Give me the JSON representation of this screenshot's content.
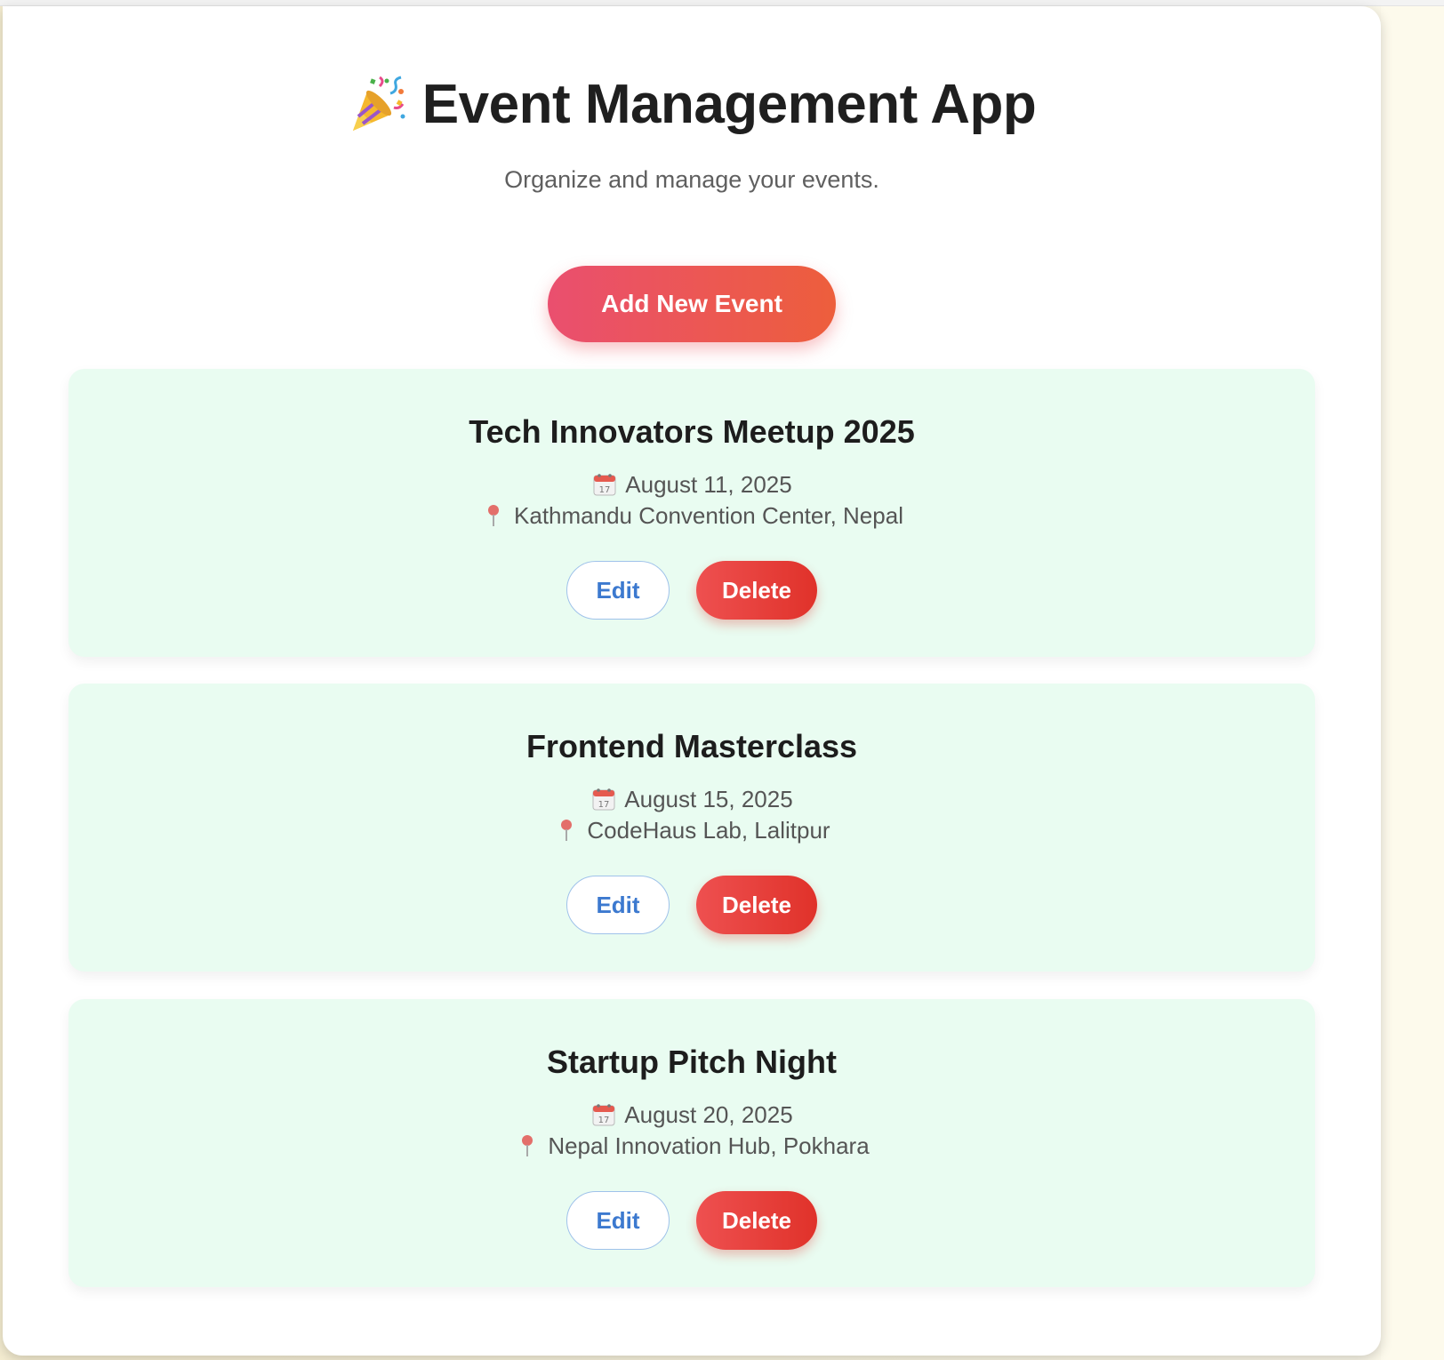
{
  "app": {
    "title": "Event Management App",
    "subtitle": "Organize and manage your events.",
    "title_icon": "party-popper-icon"
  },
  "actions": {
    "add_label": "Add New Event"
  },
  "events": [
    {
      "title": "Tech Innovators Meetup 2025",
      "date": "August 11, 2025",
      "location": "Kathmandu Convention Center, Nepal",
      "edit_label": "Edit",
      "delete_label": "Delete"
    },
    {
      "title": "Frontend Masterclass",
      "date": "August 15, 2025",
      "location": "CodeHaus Lab, Lalitpur",
      "edit_label": "Edit",
      "delete_label": "Delete"
    },
    {
      "title": "Startup Pitch Night",
      "date": "August 20, 2025",
      "location": "Nepal Innovation Hub, Pokhara",
      "edit_label": "Edit",
      "delete_label": "Delete"
    }
  ],
  "colors": {
    "accent_start": "#ea4f6f",
    "accent_end": "#ed5e3c",
    "card_bg": "#e9fcf1",
    "delete": "#e0322a",
    "edit_text": "#3c79cf"
  }
}
